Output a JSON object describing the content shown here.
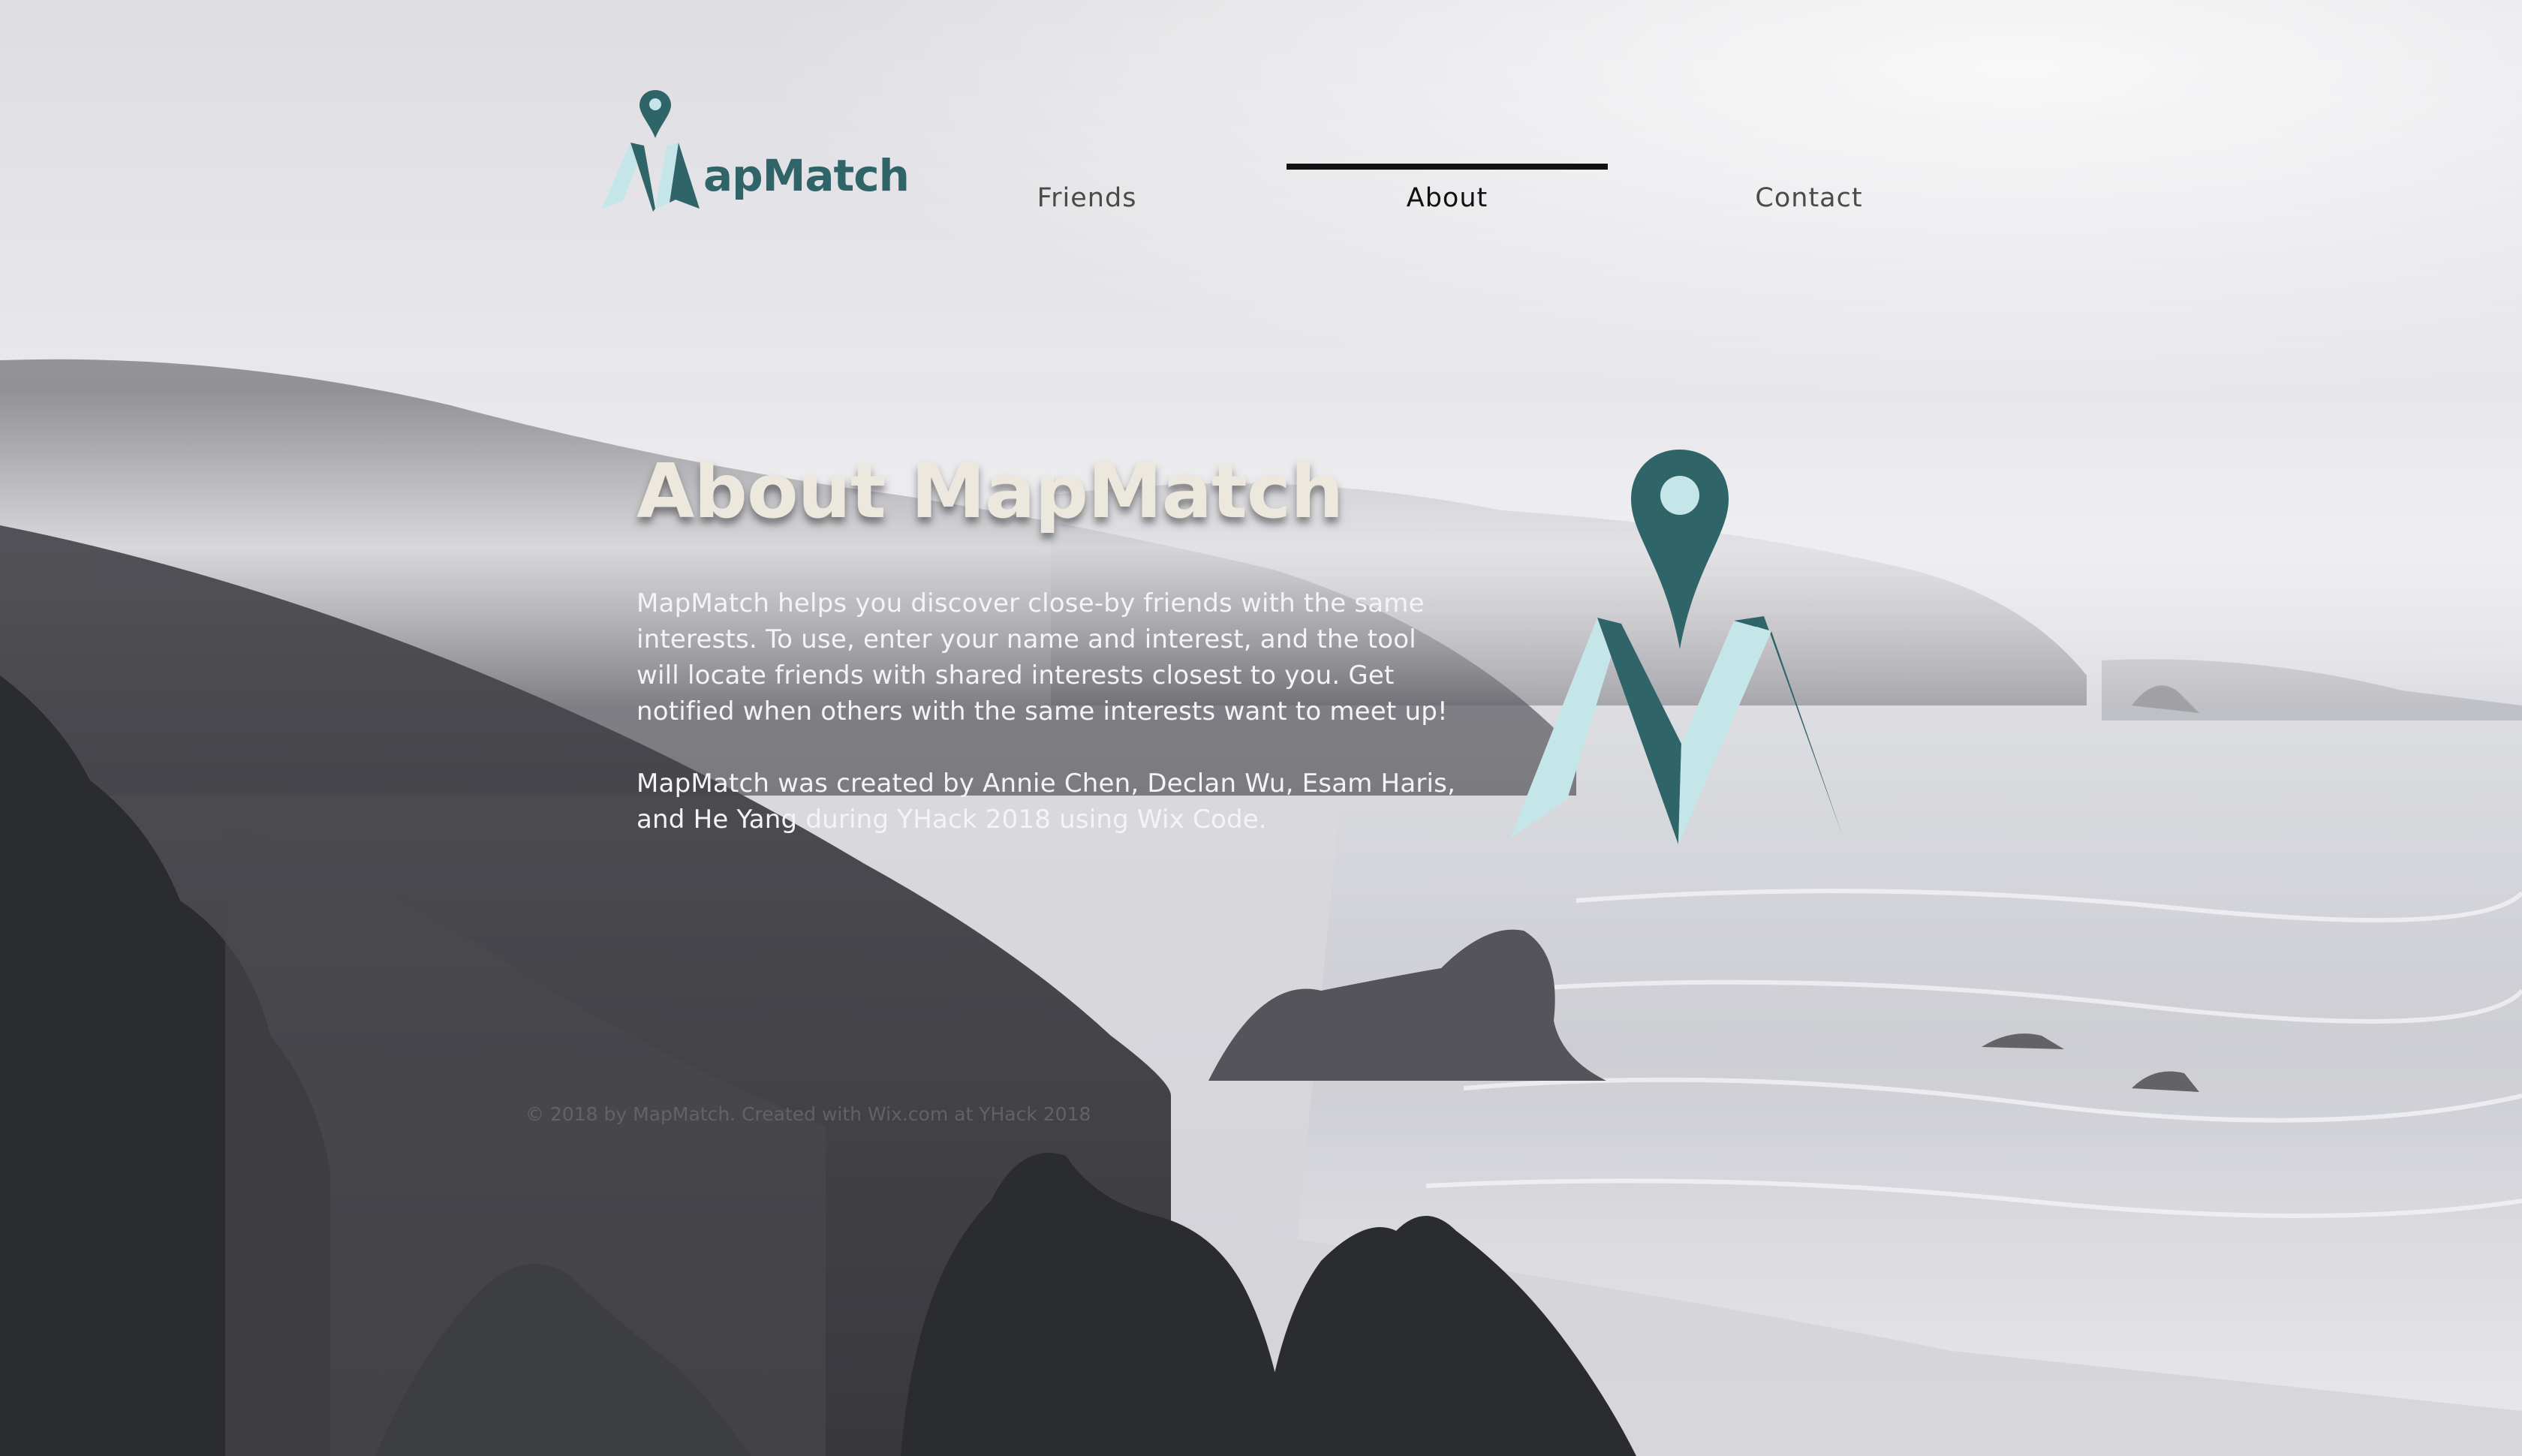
{
  "brand": {
    "name": "MapMatch",
    "logo_text": "apMatch",
    "colors": {
      "primary": "#2f6468",
      "light": "#c4e6e9",
      "heading": "#ece8dd"
    }
  },
  "nav": {
    "items": [
      {
        "label": "Friends",
        "active": false
      },
      {
        "label": "About",
        "active": true
      },
      {
        "label": "Contact",
        "active": false
      }
    ]
  },
  "content": {
    "heading": "About MapMatch",
    "paragraphs": [
      "MapMatch helps you discover close-by friends with the same interests. To use, enter your name and interest, and the tool will locate friends with shared interests closest to you. Get notified when others with the same interests want to meet up!",
      "MapMatch was created by Annie Chen, Declan Wu, Esam Haris, and He Yang during YHack 2018 using Wix Code."
    ]
  },
  "footer": {
    "text": "© 2018 by MapMatch. Created with Wix.com at YHack 2018"
  },
  "icons": {
    "logo_mark": "map-pin-m-logo-icon",
    "hero_mark": "map-pin-m-logo-icon"
  }
}
